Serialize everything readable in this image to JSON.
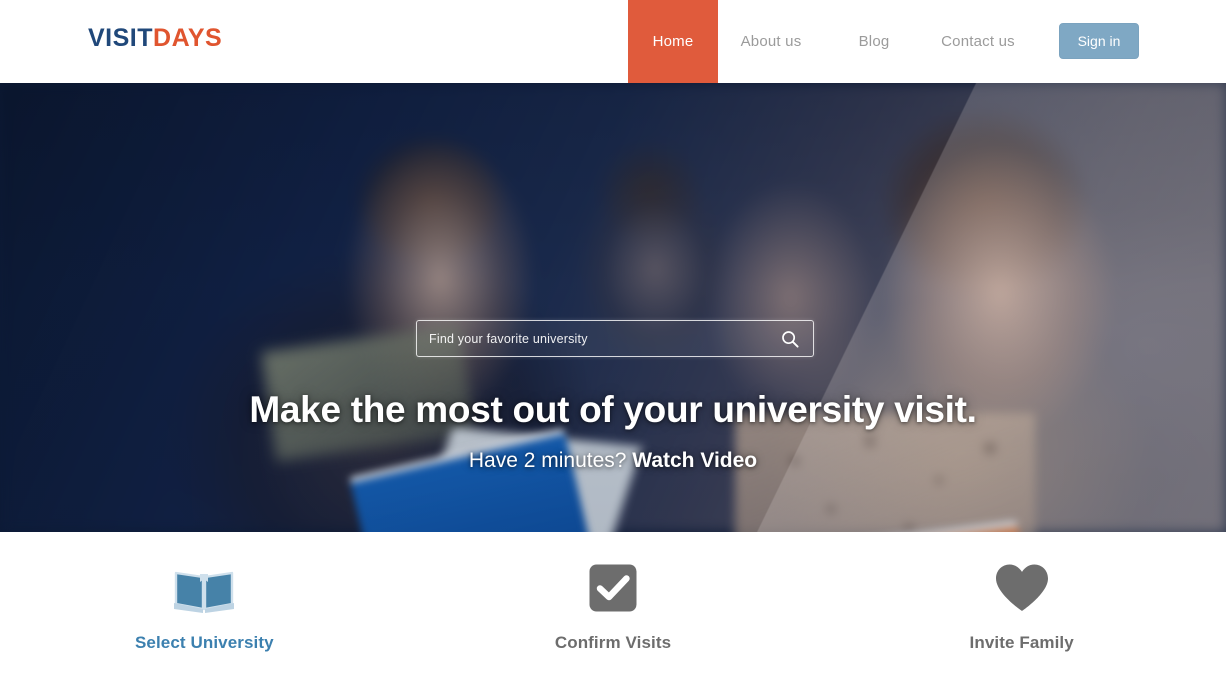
{
  "header": {
    "logo": {
      "part1": "VISIT",
      "part2": "DAYS",
      "color1": "#20487a",
      "color2": "#e0552f"
    },
    "nav": [
      {
        "label": "Home",
        "active": true,
        "name": "nav-item-home"
      },
      {
        "label": "About us",
        "active": false,
        "name": "nav-item-about-us"
      },
      {
        "label": "Blog",
        "active": false,
        "name": "nav-item-blog"
      },
      {
        "label": "Contact us",
        "active": false,
        "name": "nav-item-contact-us"
      }
    ],
    "signin_label": "Sign in",
    "accent_color": "#e05b3c",
    "signin_color": "#7fa8c4"
  },
  "hero": {
    "search": {
      "placeholder": "Find your favorite university",
      "value": "",
      "icon": "search-icon"
    },
    "title": "Make the most out of your university visit.",
    "subtitle_lead": "Have 2 minutes? ",
    "subtitle_strong": "Watch Video"
  },
  "features": [
    {
      "label": "Select University",
      "icon": "open-book-icon",
      "color": "#3c80af",
      "state": "active"
    },
    {
      "label": "Confirm Visits",
      "icon": "check-square-icon",
      "color": "#6d6d6d",
      "state": "default"
    },
    {
      "label": "Invite Family",
      "icon": "heart-icon",
      "color": "#6d6d6d",
      "state": "default"
    }
  ]
}
